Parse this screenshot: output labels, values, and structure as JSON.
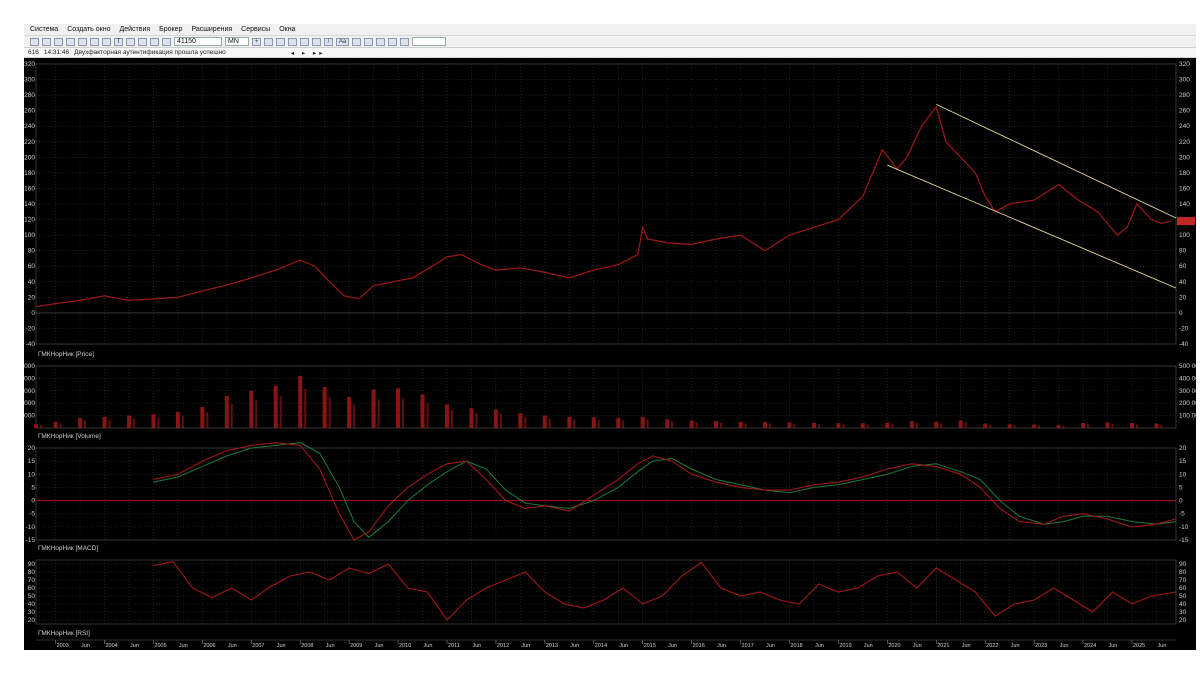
{
  "menu": [
    "Система",
    "Создать окно",
    "Действия",
    "Брокер",
    "Расширения",
    "Сервисы",
    "Окна"
  ],
  "toolbar": {
    "number_field": "41150",
    "timeframe": "MN",
    "font_label": "Aa",
    "search_placeholder": ""
  },
  "status": {
    "counter": "616",
    "time": "14:31:46",
    "message": "Двухфакторная аутентификация прошла успешно"
  },
  "colors": {
    "series": "#a01818",
    "signal": "#1f7a3a",
    "zero_line": "#9a1010",
    "channel": "#e6d9a0",
    "grid": "#3c3c3c",
    "price_marker": "#c02828"
  },
  "chart_data": [
    {
      "type": "line",
      "pane": "price",
      "label": "ГМКНорНик [Price]",
      "ylim": [
        -40,
        320
      ],
      "yticks": [
        -40,
        -20,
        0,
        20,
        40,
        60,
        80,
        100,
        120,
        140,
        160,
        180,
        200,
        220,
        240,
        260,
        280,
        300,
        320
      ],
      "x": [
        2002.6,
        2003.0,
        2003.5,
        2004.0,
        2004.5,
        2005.0,
        2005.5,
        2006.0,
        2006.5,
        2007.0,
        2007.5,
        2008.0,
        2008.3,
        2008.6,
        2008.9,
        2009.2,
        2009.5,
        2009.9,
        2010.3,
        2010.7,
        2011.0,
        2011.3,
        2011.7,
        2012.0,
        2012.5,
        2013.0,
        2013.5,
        2014.0,
        2014.5,
        2014.9,
        2015.0,
        2015.1,
        2015.5,
        2016.0,
        2016.5,
        2017.0,
        2017.5,
        2017.8,
        2018.0,
        2018.5,
        2019.0,
        2019.5,
        2019.9,
        2020.2,
        2020.4,
        2020.7,
        2021.0,
        2021.2,
        2021.5,
        2021.8,
        2022.0,
        2022.2,
        2022.5,
        2023.0,
        2023.5,
        2023.9,
        2024.3,
        2024.7,
        2024.9,
        2025.1,
        2025.4,
        2025.6,
        2025.8
      ],
      "y": [
        8,
        12,
        16,
        22,
        16,
        18,
        20,
        28,
        36,
        45,
        55,
        68,
        60,
        40,
        22,
        18,
        35,
        40,
        45,
        60,
        72,
        75,
        62,
        55,
        58,
        52,
        45,
        55,
        62,
        75,
        110,
        95,
        90,
        88,
        95,
        100,
        80,
        92,
        100,
        110,
        120,
        150,
        210,
        185,
        200,
        240,
        265,
        220,
        200,
        180,
        150,
        130,
        140,
        145,
        165,
        145,
        130,
        100,
        110,
        140,
        120,
        115,
        118
      ]
    },
    {
      "type": "line",
      "pane": "price-channel",
      "series": [
        {
          "x": [
            2021.0,
            2025.9
          ],
          "y": [
            268,
            122
          ]
        },
        {
          "x": [
            2020.0,
            2025.9
          ],
          "y": [
            190,
            32
          ]
        }
      ]
    },
    {
      "type": "bar",
      "pane": "volume",
      "label": "ГМКНорНик [Volume]",
      "ylim": [
        0,
        500000000
      ],
      "yticks": [
        100000000,
        200000000,
        300000000,
        400000000,
        500000000
      ],
      "ytick_labels": [
        "100 000 000",
        "200 000 000",
        "300 000 000",
        "400 000 000",
        "500 000 000"
      ],
      "x": [
        2002.6,
        2003.0,
        2003.5,
        2004.0,
        2004.5,
        2005.0,
        2005.5,
        2006.0,
        2006.5,
        2007.0,
        2007.5,
        2008.0,
        2008.5,
        2009.0,
        2009.5,
        2010.0,
        2010.5,
        2011.0,
        2011.5,
        2012.0,
        2012.5,
        2013.0,
        2013.5,
        2014.0,
        2014.5,
        2015.0,
        2015.5,
        2016.0,
        2016.5,
        2017.0,
        2017.5,
        2018.0,
        2018.5,
        2019.0,
        2019.5,
        2020.0,
        2020.5,
        2021.0,
        2021.5,
        2022.0,
        2022.5,
        2023.0,
        2023.5,
        2024.0,
        2024.5,
        2025.0,
        2025.5
      ],
      "values": [
        30000000,
        50000000,
        80000000,
        90000000,
        100000000,
        110000000,
        130000000,
        170000000,
        260000000,
        300000000,
        340000000,
        420000000,
        330000000,
        250000000,
        310000000,
        320000000,
        270000000,
        190000000,
        160000000,
        150000000,
        120000000,
        100000000,
        90000000,
        85000000,
        80000000,
        90000000,
        70000000,
        60000000,
        55000000,
        50000000,
        48000000,
        45000000,
        42000000,
        40000000,
        38000000,
        45000000,
        55000000,
        50000000,
        60000000,
        35000000,
        30000000,
        28000000,
        25000000,
        40000000,
        45000000,
        40000000,
        35000000
      ]
    },
    {
      "type": "line",
      "pane": "macd",
      "label": "ГМКНорНик [MACD]",
      "ylim": [
        -15,
        20
      ],
      "yticks": [
        -15,
        -10,
        -5,
        0,
        5,
        10,
        15,
        20
      ],
      "x": [
        2005.0,
        2005.5,
        2006.0,
        2006.5,
        2007.0,
        2007.5,
        2008.0,
        2008.4,
        2008.8,
        2009.1,
        2009.4,
        2009.8,
        2010.2,
        2010.6,
        2011.0,
        2011.4,
        2011.8,
        2012.2,
        2012.6,
        2013.0,
        2013.5,
        2014.0,
        2014.5,
        2014.9,
        2015.2,
        2015.6,
        2016.0,
        2016.5,
        2017.0,
        2017.5,
        2018.0,
        2018.5,
        2019.0,
        2019.5,
        2020.0,
        2020.5,
        2021.0,
        2021.5,
        2021.9,
        2022.3,
        2022.7,
        2023.2,
        2023.6,
        2024.0,
        2024.5,
        2025.0,
        2025.5,
        2025.9
      ],
      "series": [
        {
          "values": [
            8,
            10,
            15,
            19,
            21,
            22,
            21,
            12,
            -5,
            -15,
            -12,
            -2,
            5,
            10,
            14,
            15,
            8,
            0,
            -3,
            -2,
            -4,
            2,
            8,
            14,
            17,
            15,
            10,
            7,
            5,
            4,
            4,
            6,
            7,
            9,
            12,
            14,
            13,
            10,
            5,
            -3,
            -8,
            -9,
            -6,
            -5,
            -7,
            -10,
            -9,
            -7
          ]
        },
        {
          "values": [
            7,
            9,
            13,
            17,
            20,
            21,
            22,
            18,
            5,
            -8,
            -14,
            -8,
            0,
            6,
            11,
            15,
            12,
            4,
            -1,
            -2,
            -3,
            0,
            5,
            11,
            15,
            16,
            12,
            8,
            6,
            4,
            3,
            5,
            6,
            8,
            10,
            13,
            14,
            11,
            8,
            0,
            -6,
            -9,
            -8,
            -6,
            -6,
            -8,
            -9,
            -8
          ]
        }
      ]
    },
    {
      "type": "line",
      "pane": "rsi",
      "label": "ГМКНорНик [RSI]",
      "ylim": [
        15,
        95
      ],
      "yticks": [
        20,
        30,
        40,
        50,
        60,
        70,
        80,
        90
      ],
      "x": [
        2005.0,
        2005.4,
        2005.8,
        2006.2,
        2006.6,
        2007.0,
        2007.4,
        2007.8,
        2008.2,
        2008.6,
        2009.0,
        2009.4,
        2009.8,
        2010.2,
        2010.6,
        2011.0,
        2011.4,
        2011.8,
        2012.2,
        2012.6,
        2013.0,
        2013.4,
        2013.8,
        2014.2,
        2014.6,
        2015.0,
        2015.4,
        2015.8,
        2016.2,
        2016.6,
        2017.0,
        2017.4,
        2017.8,
        2018.2,
        2018.6,
        2019.0,
        2019.4,
        2019.8,
        2020.2,
        2020.6,
        2021.0,
        2021.4,
        2021.8,
        2022.2,
        2022.6,
        2023.0,
        2023.4,
        2023.8,
        2024.2,
        2024.6,
        2025.0,
        2025.4,
        2025.9
      ],
      "values": [
        88,
        93,
        60,
        48,
        60,
        45,
        62,
        75,
        80,
        70,
        85,
        78,
        90,
        60,
        55,
        20,
        45,
        60,
        70,
        80,
        55,
        40,
        35,
        45,
        60,
        40,
        50,
        75,
        92,
        60,
        50,
        55,
        45,
        40,
        65,
        55,
        60,
        75,
        80,
        60,
        85,
        70,
        55,
        25,
        40,
        45,
        60,
        45,
        30,
        55,
        40,
        50,
        55
      ]
    }
  ],
  "x_axis": {
    "years": [
      2003,
      2004,
      2005,
      2006,
      2007,
      2008,
      2009,
      2010,
      2011,
      2012,
      2013,
      2014,
      2015,
      2016,
      2017,
      2018,
      2019,
      2020,
      2021,
      2022,
      2023,
      2024,
      2025
    ],
    "month_label": "Jun",
    "xlim": [
      2002.6,
      2025.9
    ]
  }
}
